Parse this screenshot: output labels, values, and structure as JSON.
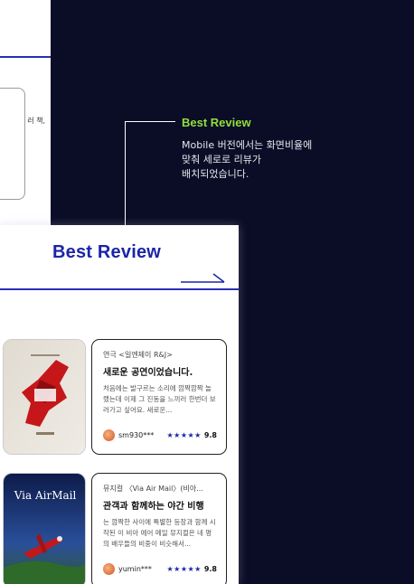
{
  "top_fragment": {
    "text": "러 책,"
  },
  "annotation": {
    "title": "Best Review",
    "description": "Mobile 버전에서는 화면비율에\n맞춰 세로로 리뷰가\n배치되었습니다."
  },
  "section": {
    "title": "Best Review",
    "arrow_icon": "arrow-right-icon"
  },
  "reviews": [
    {
      "category": "연극 <일엔제이 R&J>",
      "title": "새로운 공연이었습니다.",
      "body": "처음에는 발구르는 소리에 깜짝깜짝 놀랬는데 이제 그 진동을 느끼러 한번더 보러가고 싶어요. 새로운...",
      "user": "sm930***",
      "stars": "★★★★★",
      "score": "9.8"
    },
    {
      "category": "뮤지컬 〈Via Air Mail〉(비아...",
      "title": "관객과 함께하는 야간 비행",
      "body": "는 깜짝한 사이에 특별한 등장과 함께 시작된 이 비아 에어 메일 뮤지컬은 네 명의 배우들의 비중이 비슷해서...",
      "user": "yumin***",
      "stars": "★★★★★",
      "score": "9.8"
    }
  ],
  "colors": {
    "background": "#0b0c26",
    "accent": "#1c25a8",
    "annotation_title": "#8fe03a"
  }
}
